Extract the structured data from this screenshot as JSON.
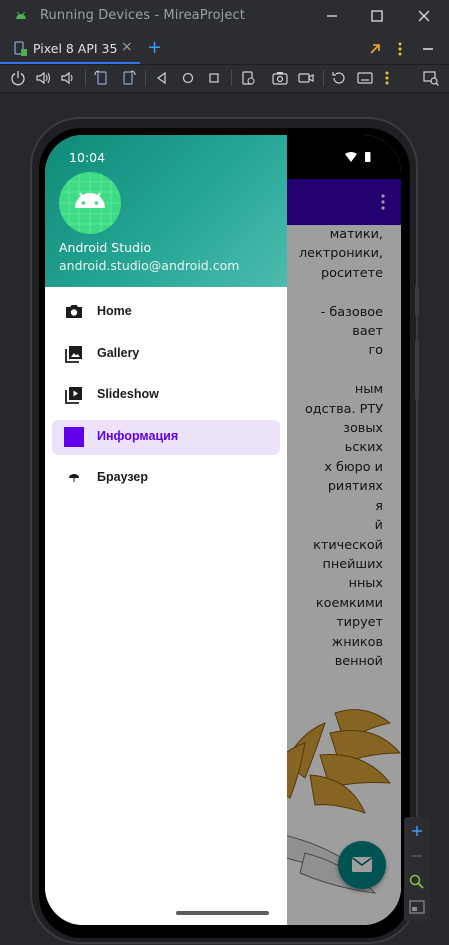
{
  "ide": {
    "window_title": "Running Devices - MireaProject",
    "device_tab_label": "Pixel 8 API 35",
    "tab_close": "×",
    "add_tab": "+"
  },
  "device": {
    "status_time": "10:04"
  },
  "drawer": {
    "header_title": "Android Studio",
    "header_subtitle": "android.studio@android.com",
    "items": [
      {
        "label": "Home",
        "icon": "camera-icon",
        "active": false
      },
      {
        "label": "Gallery",
        "icon": "gallery-icon",
        "active": false
      },
      {
        "label": "Slideshow",
        "icon": "slideshow-icon",
        "active": false
      },
      {
        "label": "Информация",
        "icon": "info-square-icon",
        "active": true
      },
      {
        "label": "Браузер",
        "icon": "umbrella-icon",
        "active": false
      }
    ]
  },
  "content": {
    "lines": [
      "матики,",
      "лектроники,",
      "роситете",
      "",
      "- базовое",
      "вает",
      "го",
      "",
      "ным",
      "одства. РТУ",
      "зовых",
      "ьских",
      "х бюро и",
      "риятиях",
      "я",
      "й",
      "ктической",
      "пнейших",
      "нных",
      "коемкими",
      "тирует",
      "жников",
      "венной"
    ]
  },
  "colors": {
    "app_bar": "#3700b3",
    "fab": "#018786",
    "active_item_bg": "#ece2f9",
    "active_item_text": "#6200ee",
    "drawer_header": "#26a595"
  }
}
